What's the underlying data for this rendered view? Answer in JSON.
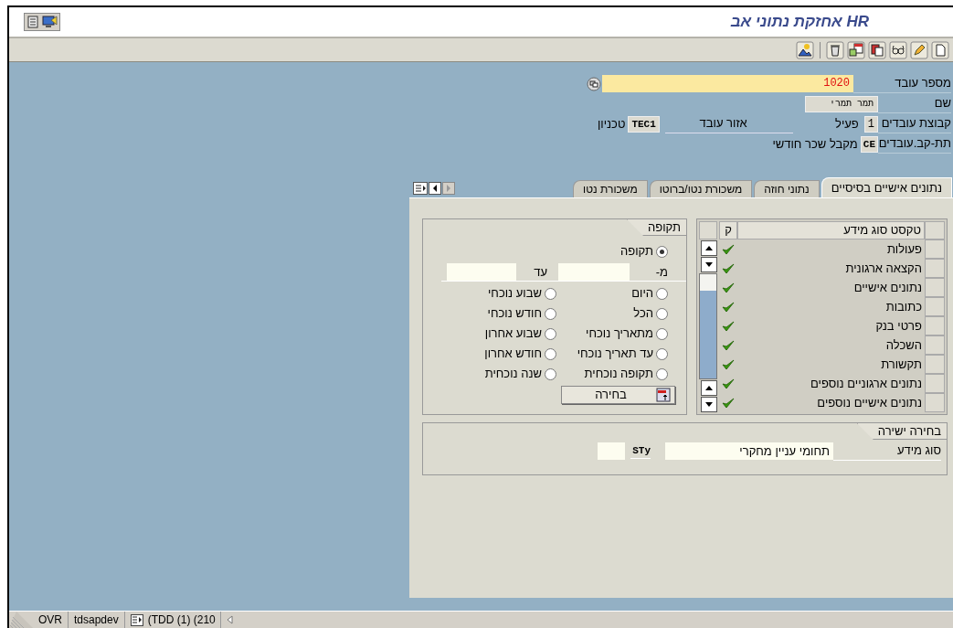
{
  "title_bar": {
    "title": "HR אחזקת נתוני אב"
  },
  "header": {
    "employee_number": {
      "label": "מספר עובד",
      "value": "1020"
    },
    "name": {
      "label": "שם",
      "value": "תמר תמרי"
    },
    "employee_group": {
      "label": "קבוצת עובדים",
      "value": "1",
      "text": "פעיל"
    },
    "personnel_area": {
      "label": "אזור עובד",
      "value": "TEC1",
      "text": "טכניון"
    },
    "employee_subgroup": {
      "label": "תת-קב.עובדים",
      "value": "CE",
      "text": "מקבל שכר חודשי"
    }
  },
  "tabs": [
    {
      "label": "נתונים אישיים בסיסיים",
      "selected": true
    },
    {
      "label": "נתוני חוזה",
      "selected": false
    },
    {
      "label": "משכורת נטו/ברוטו",
      "selected": false
    },
    {
      "label": "משכורת נטו",
      "selected": false
    }
  ],
  "infotypes": {
    "columns": [
      "טקסט סוג מידע",
      "ק"
    ],
    "rows": [
      {
        "text": "פעולות",
        "checked": true
      },
      {
        "text": "הקצאה ארגונית",
        "checked": true
      },
      {
        "text": "נתונים אישיים",
        "checked": true
      },
      {
        "text": "כתובות",
        "checked": true
      },
      {
        "text": "פרטי בנק",
        "checked": true
      },
      {
        "text": "השכלה",
        "checked": true
      },
      {
        "text": "תקשורת",
        "checked": true
      },
      {
        "text": "נתונים ארגוניים נוספים",
        "checked": true
      },
      {
        "text": "נתונים אישיים נוספים",
        "checked": true
      }
    ]
  },
  "period": {
    "title": "תקופה",
    "custom": {
      "label": "תקופה",
      "selected": true
    },
    "from_label": "מ-",
    "to_label": "עד",
    "options": [
      {
        "label": "היום",
        "selected": false
      },
      {
        "label": "שבוע נוכחי",
        "selected": false
      },
      {
        "label": "הכל",
        "selected": false
      },
      {
        "label": "חודש נוכחי",
        "selected": false
      },
      {
        "label": "מתאריך נוכחי",
        "selected": false
      },
      {
        "label": "שבוע אחרון",
        "selected": false
      },
      {
        "label": "עד תאריך נוכחי",
        "selected": false
      },
      {
        "label": "חודש אחרון",
        "selected": false
      },
      {
        "label": "תקופה נוכחית",
        "selected": false
      },
      {
        "label": "שנה נוכחית",
        "selected": false
      }
    ],
    "button": "בחירה"
  },
  "direct_selection": {
    "title": "בחירה ישירה",
    "label": "סוג מידע",
    "value": "תחומי עניין מחקרי",
    "code": "STy"
  },
  "status_bar": {
    "mode": "OVR",
    "server": "tdsapdev",
    "session": "(TDD (1) (210"
  }
}
